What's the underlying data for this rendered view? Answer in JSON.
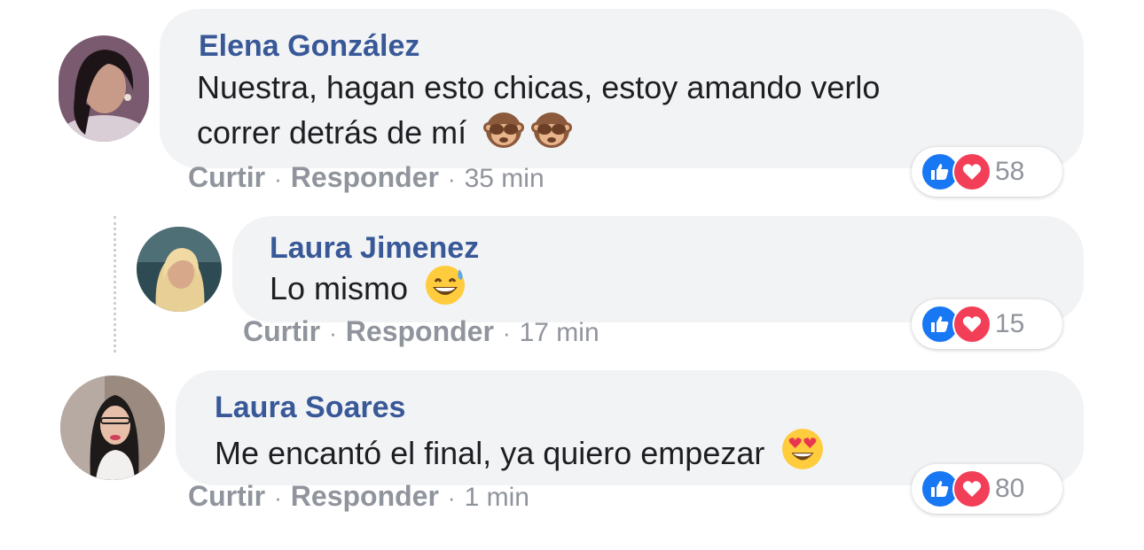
{
  "comments": [
    {
      "author": "Elena González",
      "text_line1": "Nuestra, hagan esto chicas, estoy amando verlo",
      "text_line2": "correr detrás de mí",
      "emoji": [
        "see-no-evil-monkey",
        "see-no-evil-monkey"
      ],
      "like_label": "Curtir",
      "reply_label": "Responder",
      "time": "35 min",
      "reaction_count": "58"
    },
    {
      "author": "Laura Jimenez",
      "text": "Lo mismo",
      "emoji": [
        "grinning-sweat"
      ],
      "like_label": "Curtir",
      "reply_label": "Responder",
      "time": "17 min",
      "reaction_count": "15"
    },
    {
      "author": "Laura Soares",
      "text": "Me encantó el final, ya quiero empezar",
      "emoji": [
        "heart-eyes"
      ],
      "like_label": "Curtir",
      "reply_label": "Responder",
      "time": "1 min",
      "reaction_count": "80"
    }
  ],
  "colors": {
    "author": "#385898",
    "bubble": "#f2f3f5",
    "meta": "#90949c",
    "like": "#1877f2",
    "love": "#f33e58"
  }
}
